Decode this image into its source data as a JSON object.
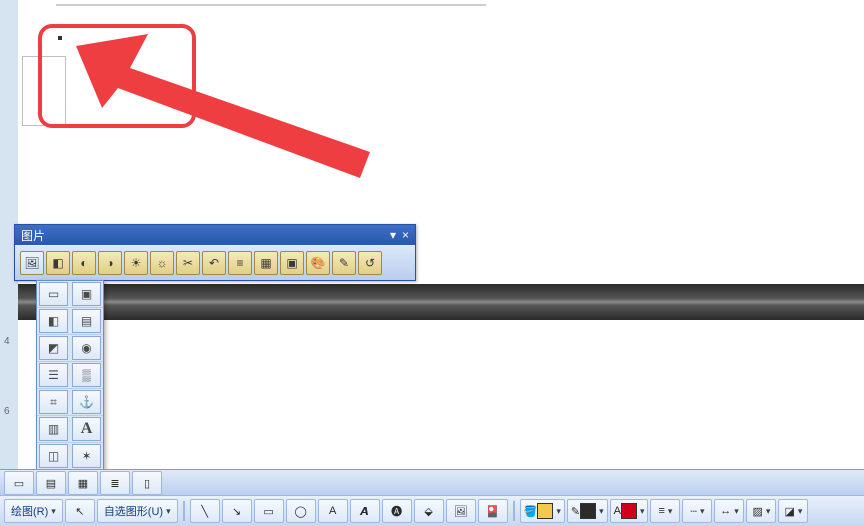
{
  "annotation": {
    "note": "red-arrow-callout"
  },
  "picture_toolbar": {
    "title": "图片",
    "close_glyph": "×",
    "options_glyph": "▾",
    "buttons": [
      {
        "name": "insert-picture-icon",
        "glyph": "🖼"
      },
      {
        "name": "color-icon",
        "glyph": "◧"
      },
      {
        "name": "more-contrast-icon",
        "glyph": "◐"
      },
      {
        "name": "less-contrast-icon",
        "glyph": "◑"
      },
      {
        "name": "more-brightness-icon",
        "glyph": "☀"
      },
      {
        "name": "less-brightness-icon",
        "glyph": "☼"
      },
      {
        "name": "crop-icon",
        "glyph": "✂"
      },
      {
        "name": "rotate-left-icon",
        "glyph": "↶"
      },
      {
        "name": "line-style-icon",
        "glyph": "≡"
      },
      {
        "name": "compress-pictures-icon",
        "glyph": "▦"
      },
      {
        "name": "text-wrapping-icon",
        "glyph": "▣"
      },
      {
        "name": "format-picture-icon",
        "glyph": "🎨"
      },
      {
        "name": "set-transparent-color-icon",
        "glyph": "✎"
      },
      {
        "name": "reset-picture-icon",
        "glyph": "↺"
      }
    ]
  },
  "text_wrap_menu": {
    "rows": [
      [
        {
          "name": "wrap-inline-icon",
          "glyph": "▭"
        },
        {
          "name": "wrap-square-icon",
          "glyph": "▣"
        }
      ],
      [
        {
          "name": "wrap-tight-icon",
          "glyph": "◧"
        },
        {
          "name": "wrap-behind-text-icon",
          "glyph": "▤"
        }
      ],
      [
        {
          "name": "wrap-in-front-icon",
          "glyph": "◩"
        },
        {
          "name": "wrap-through-icon",
          "glyph": "◉"
        }
      ],
      [
        {
          "name": "wrap-top-bottom-icon",
          "glyph": "☰"
        },
        {
          "name": "wrap-edit-points-icon",
          "glyph": "▒"
        }
      ],
      [
        {
          "name": "wrap-more-layout-icon",
          "glyph": "⌗"
        },
        {
          "name": "wrap-anchor-icon",
          "glyph": "⚓"
        }
      ],
      [
        {
          "name": "wrap-text-icon",
          "glyph": "▥"
        },
        {
          "name": "wrap-letter-icon",
          "glyph": "A"
        }
      ],
      [
        {
          "name": "wrap-option-a-icon",
          "glyph": "◫"
        },
        {
          "name": "wrap-option-b-icon",
          "glyph": "✶"
        }
      ]
    ]
  },
  "bottom_view_buttons": [
    {
      "name": "normal-view-icon",
      "glyph": "▭"
    },
    {
      "name": "web-layout-view-icon",
      "glyph": "▤"
    },
    {
      "name": "print-layout-view-icon",
      "glyph": "▦"
    },
    {
      "name": "outline-view-icon",
      "glyph": "≣"
    },
    {
      "name": "reading-view-icon",
      "glyph": "▯"
    }
  ],
  "drawing_toolbar": {
    "draw_menu_label": "绘图(R)",
    "select_arrow": "↖",
    "autoshapes_label": "自选图形(U)",
    "shape_buttons": [
      {
        "name": "line-icon",
        "glyph": "╲"
      },
      {
        "name": "arrow-icon",
        "glyph": "↘"
      },
      {
        "name": "rectangle-icon",
        "glyph": "▭"
      },
      {
        "name": "oval-icon",
        "glyph": "◯"
      },
      {
        "name": "text-box-icon",
        "glyph": "A"
      },
      {
        "name": "vertical-text-box-icon",
        "glyph": "𝘼"
      },
      {
        "name": "wordart-icon",
        "glyph": "🅐"
      },
      {
        "name": "diagram-icon",
        "glyph": "⬙"
      },
      {
        "name": "clipart-icon",
        "glyph": "🖼"
      },
      {
        "name": "picture-icon",
        "glyph": "🎴"
      }
    ],
    "format_buttons": [
      {
        "name": "fill-color-icon",
        "glyph": "🪣",
        "chip": "#f2c94c"
      },
      {
        "name": "line-color-icon",
        "glyph": "✎",
        "chip": "#2b2b2b"
      },
      {
        "name": "font-color-icon",
        "glyph": "A",
        "chip": "#d0021b"
      },
      {
        "name": "line-style-icon",
        "glyph": "≡"
      },
      {
        "name": "dash-style-icon",
        "glyph": "┄"
      },
      {
        "name": "arrow-style-icon",
        "glyph": "↔"
      },
      {
        "name": "shadow-style-icon",
        "glyph": "▨"
      },
      {
        "name": "3d-style-icon",
        "glyph": "◪"
      }
    ]
  },
  "ruler_marks": [
    "4",
    "6"
  ]
}
